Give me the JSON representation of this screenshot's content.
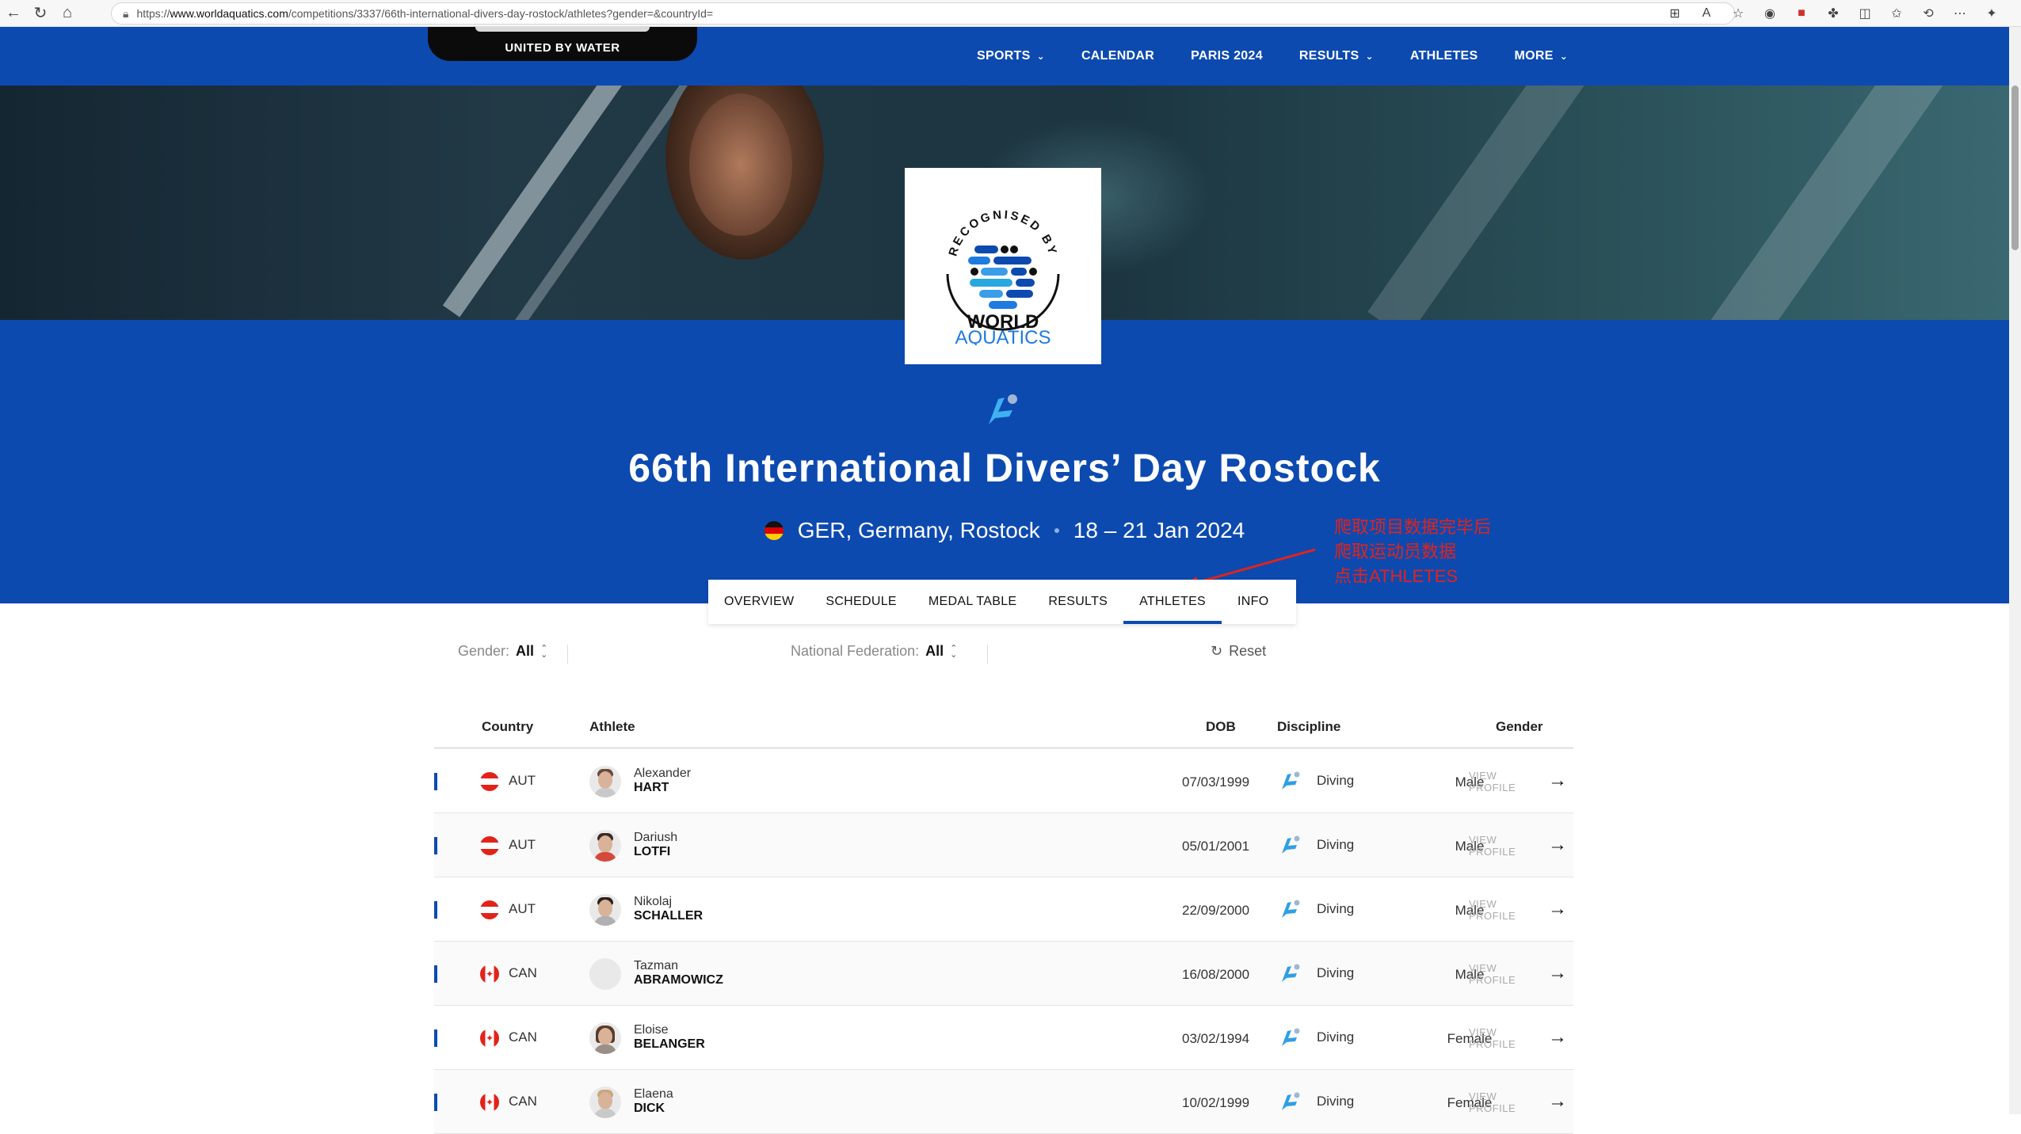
{
  "browser": {
    "url_prefix": "https://",
    "url_domain": "www.worldaquatics.com",
    "url_path": "/competitions/3337/66th-international-divers-day-rostock/athletes?gender=&countryId="
  },
  "header": {
    "logo_tagline": "UNITED BY WATER",
    "nav": [
      {
        "label": "SPORTS"
      },
      {
        "label": "CALENDAR"
      },
      {
        "label": "PARIS 2024"
      },
      {
        "label": "RESULTS"
      },
      {
        "label": "ATHLETES"
      },
      {
        "label": "MORE"
      }
    ]
  },
  "badge": {
    "arc_text": "RECOGNISED BY",
    "line1": "WORLD",
    "line2": "AQUATICS"
  },
  "competition": {
    "title": "66th International Divers’ Day Rostock",
    "location": "GER, Germany, Rostock",
    "dates": "18 – 21 Jan 2024"
  },
  "annotation": {
    "line1": "爬取项目数据完毕后",
    "line2": "爬取运动员数据",
    "line3": "点击ATHLETES"
  },
  "tabs": [
    {
      "label": "OVERVIEW",
      "active": false
    },
    {
      "label": "SCHEDULE",
      "active": false
    },
    {
      "label": "MEDAL TABLE",
      "active": false
    },
    {
      "label": "RESULTS",
      "active": false
    },
    {
      "label": "ATHLETES",
      "active": true
    },
    {
      "label": "INFO",
      "active": false
    }
  ],
  "filters": {
    "gender_label": "Gender:",
    "gender_value": "All",
    "federation_label": "National Federation:",
    "federation_value": "All",
    "reset_label": "Reset"
  },
  "table": {
    "headers": {
      "country": "Country",
      "athlete": "Athlete",
      "gender": "Gender",
      "dob": "DOB",
      "discipline": "Discipline"
    },
    "view_line1": "VIEW",
    "view_line2": "PROFILE",
    "rows": [
      {
        "country": "AUT",
        "first": "Alexander",
        "last": "HART",
        "gender": "Male",
        "dob": "07/03/1999",
        "discipline": "Diving"
      },
      {
        "country": "AUT",
        "first": "Dariush",
        "last": "LOTFI",
        "gender": "Male",
        "dob": "05/01/2001",
        "discipline": "Diving"
      },
      {
        "country": "AUT",
        "first": "Nikolaj",
        "last": "SCHALLER",
        "gender": "Male",
        "dob": "22/09/2000",
        "discipline": "Diving"
      },
      {
        "country": "CAN",
        "first": "Tazman",
        "last": "ABRAMOWICZ",
        "gender": "Male",
        "dob": "16/08/2000",
        "discipline": "Diving"
      },
      {
        "country": "CAN",
        "first": "Eloise",
        "last": "BELANGER",
        "gender": "Female",
        "dob": "03/02/1994",
        "discipline": "Diving"
      },
      {
        "country": "CAN",
        "first": "Elaena",
        "last": "DICK",
        "gender": "Female",
        "dob": "10/02/1999",
        "discipline": "Diving"
      }
    ]
  },
  "colors": {
    "brand_blue": "#0d4ab0",
    "annotation_red": "#e2231a"
  }
}
